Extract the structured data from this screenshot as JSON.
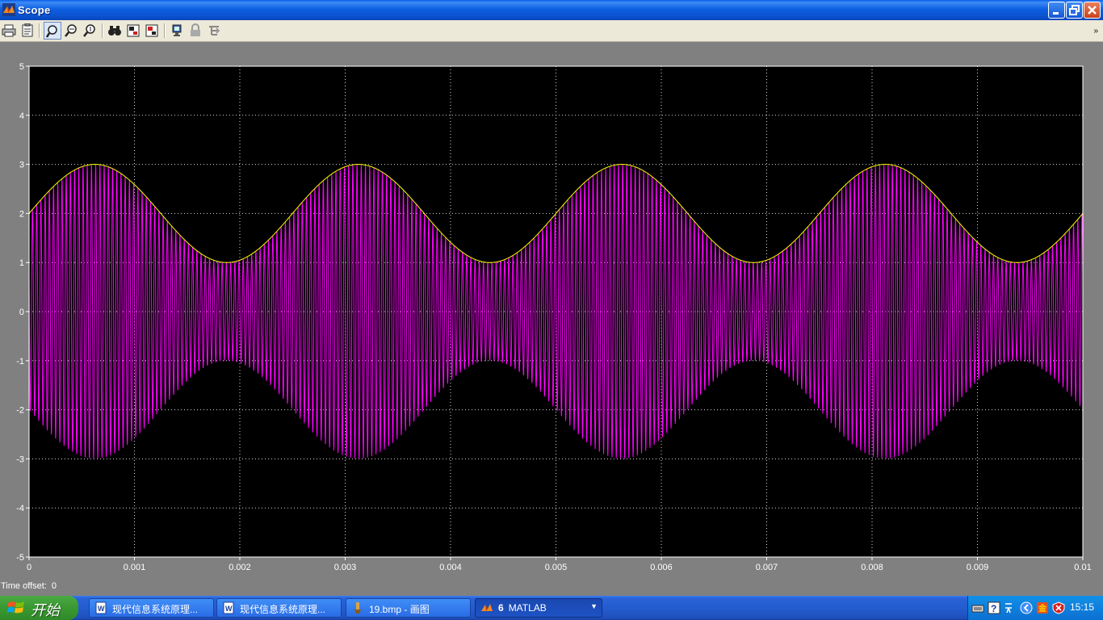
{
  "window": {
    "title": "Scope",
    "icon": "matlab-simulink-icon"
  },
  "toolbar": {
    "buttons": [
      {
        "name": "print-icon"
      },
      {
        "name": "parameters-icon"
      },
      {
        "name": "zoom-icon"
      },
      {
        "name": "zoom-x-icon"
      },
      {
        "name": "zoom-y-icon"
      },
      {
        "name": "autoscale-icon"
      },
      {
        "name": "save-axes-settings-icon"
      },
      {
        "name": "restore-axes-settings-icon"
      },
      {
        "name": "floating-scope-icon"
      },
      {
        "name": "lock-axes-icon"
      },
      {
        "name": "signal-selection-icon"
      }
    ],
    "overflow": "»"
  },
  "time_offset": {
    "label": "Time offset:",
    "value": "0"
  },
  "chart_data": {
    "type": "line",
    "title": "",
    "xlabel": "",
    "ylabel": "",
    "xlim": [
      0,
      0.01
    ],
    "ylim": [
      -5,
      5
    ],
    "x_ticks": [
      "0",
      "0.001",
      "0.002",
      "0.003",
      "0.004",
      "0.005",
      "0.006",
      "0.007",
      "0.008",
      "0.009",
      "0.01"
    ],
    "y_ticks": [
      "5",
      "4",
      "3",
      "2",
      "1",
      "0",
      "-1",
      "-2",
      "-3",
      "-4",
      "-5"
    ],
    "grid": true,
    "background": "#000000",
    "series": [
      {
        "kind": "AM modulated signal",
        "color": "#ff00ff",
        "envelope_upper": {
          "mean": 2,
          "amplitude": 1,
          "period": 0.0025,
          "peak_at": 0.000625
        },
        "carrier_cycles_in_window": 250,
        "range": [
          -3,
          3
        ]
      },
      {
        "kind": "envelope",
        "color": "#ffff00",
        "points": [
          [
            0,
            2
          ],
          [
            0.000625,
            3
          ],
          [
            0.00125,
            2
          ],
          [
            0.001875,
            1
          ],
          [
            0.0025,
            2
          ],
          [
            0.003125,
            3
          ],
          [
            0.00375,
            2
          ],
          [
            0.004375,
            1
          ],
          [
            0.005,
            2
          ],
          [
            0.005625,
            3
          ],
          [
            0.00625,
            2
          ],
          [
            0.006875,
            1
          ],
          [
            0.0075,
            2
          ],
          [
            0.008125,
            3
          ],
          [
            0.00875,
            2
          ],
          [
            0.009375,
            1
          ],
          [
            0.01,
            2
          ]
        ]
      }
    ]
  },
  "taskbar": {
    "start_label": "开始",
    "tasks": [
      {
        "label": "现代信息系统原理...",
        "icon": "word-document-icon",
        "active": false
      },
      {
        "label": "现代信息系统原理...",
        "icon": "word-document-icon",
        "active": false
      },
      {
        "label": "19.bmp - 画图",
        "icon": "paint-icon",
        "active": false
      },
      {
        "count": "6",
        "label": "MATLAB",
        "icon": "matlab-icon",
        "active": true
      }
    ],
    "clock": "15:15"
  }
}
